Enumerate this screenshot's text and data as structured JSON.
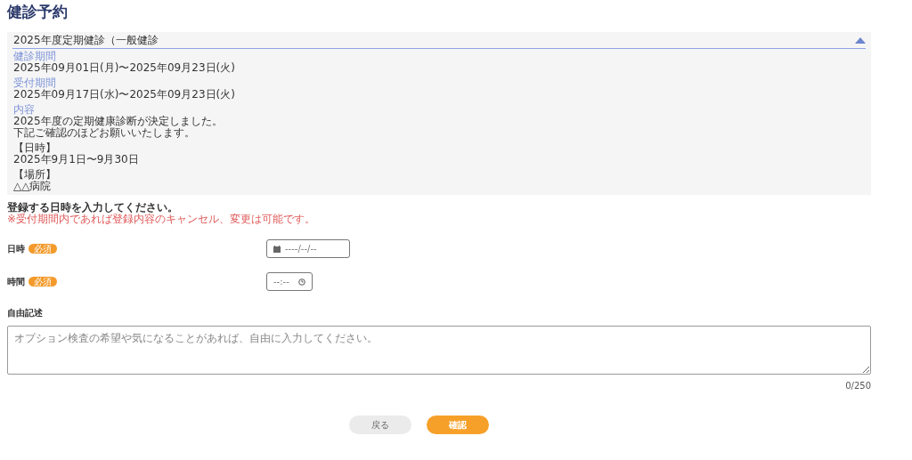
{
  "title": "健診予約",
  "notice": {
    "heading": "2025年度定期健診（一般健診",
    "expanded": true,
    "sections": [
      {
        "label": "健診期間",
        "lines": [
          "2025年09月01日(月)〜2025年09月23日(火)"
        ]
      },
      {
        "label": "受付期間",
        "lines": [
          "2025年09月17日(水)〜2025年09月23日(火)"
        ]
      },
      {
        "label": "内容",
        "lines": [
          "2025年度の定期健康診断が決定しました。",
          "下記ご確認のほどお願いいたします。"
        ]
      },
      {
        "lines": [
          "【日時】",
          "2025年9月1日〜9月30日"
        ]
      },
      {
        "lines": [
          "【場所】",
          "△△病院"
        ]
      }
    ]
  },
  "instruction": "登録する日時を入力してください。",
  "note": "※受付期間内であれば登録内容のキャンセル、変更は可能です。",
  "fields": [
    {
      "kind": "date",
      "label": "日時",
      "badge": "必須",
      "placeholder": "----/--/--"
    },
    {
      "kind": "time",
      "label": "時間",
      "badge": "必須",
      "placeholder": "--:--"
    }
  ],
  "free_text": {
    "label": "自由記述",
    "placeholder": "オプション検査の希望や気になることがあれば、自由に入力してください。",
    "counter": "0/250"
  },
  "buttons": [
    {
      "label": "戻る",
      "kind": "secondary"
    },
    {
      "label": "確認",
      "kind": "primary"
    }
  ]
}
